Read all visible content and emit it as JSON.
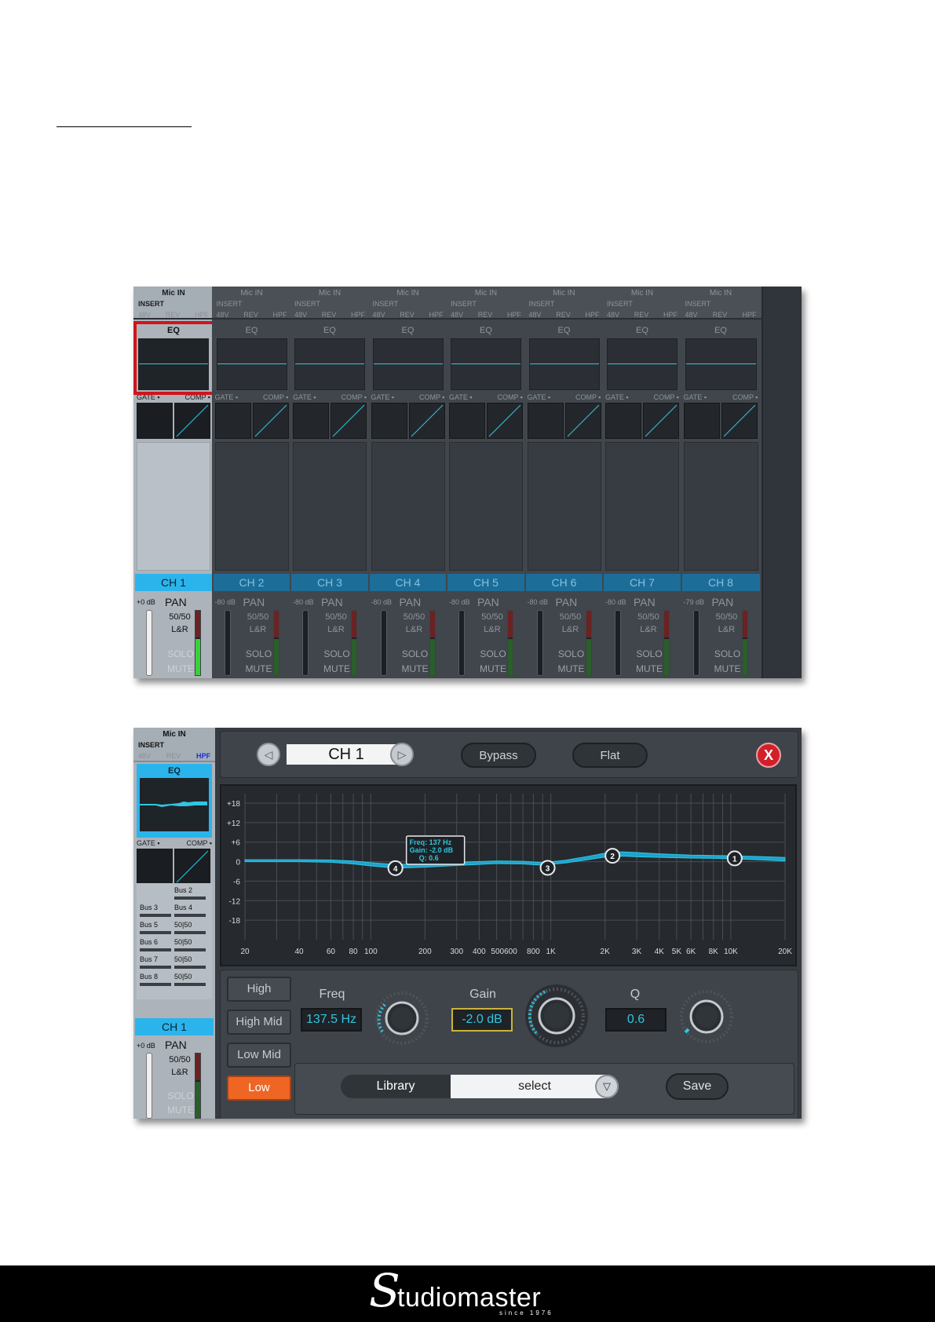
{
  "mixer": {
    "labels": {
      "mic": "Mic IN",
      "insert": "INSERT",
      "p48": "48V",
      "rev": "REV",
      "hpf": "HPF",
      "eq": "EQ",
      "gate": "GATE ▪",
      "comp": "COMP ▪",
      "pan": "PAN",
      "pan_value": "50/50",
      "pan_route": "L&R",
      "solo": "SOLO",
      "mute": "MUTE"
    },
    "channels": [
      {
        "name": "CH 1",
        "db": "+0 dB",
        "selected": true
      },
      {
        "name": "CH 2",
        "db": "-80 dB"
      },
      {
        "name": "CH 3",
        "db": "-80 dB"
      },
      {
        "name": "CH 4",
        "db": "-80 dB"
      },
      {
        "name": "CH 5",
        "db": "-80 dB"
      },
      {
        "name": "CH 6",
        "db": "-80 dB"
      },
      {
        "name": "CH 7",
        "db": "-80 dB"
      },
      {
        "name": "CH 8",
        "db": "-79 dB"
      }
    ],
    "highlight_color": "#d1141c"
  },
  "side": {
    "buses": [
      {
        "left": "",
        "right": "Bus 2"
      },
      {
        "left": "Bus 3",
        "right": "Bus 4"
      },
      {
        "left": "Bus 5",
        "right": "50|50"
      },
      {
        "left": "Bus 6",
        "right": "50|50"
      },
      {
        "left": "Bus 7",
        "right": "50|50"
      },
      {
        "left": "Bus 8",
        "right": "50|50"
      }
    ],
    "channel": "CH 1",
    "db": "+0 dB"
  },
  "eq": {
    "channel": "CH 1",
    "prev_icon": "triangle-left-icon",
    "next_icon": "triangle-right-icon",
    "bypass": "Bypass",
    "flat": "Flat",
    "close": "X",
    "y_ticks": [
      "+18",
      "+12",
      "+6",
      "0",
      "-6",
      "-12",
      "-18"
    ],
    "x_ticks": [
      "20",
      "40",
      "60",
      "80",
      "100",
      "200",
      "300",
      "400",
      "500600",
      "800",
      "1K",
      "2K",
      "3K",
      "4K",
      "5K",
      "6K",
      "8K",
      "10K",
      "20K"
    ],
    "tooltip": {
      "line1": "Freq: 137 Hz",
      "line2": "Gain: -2.0 dB",
      "line3": "Q: 0.6"
    },
    "points": [
      {
        "label": "1",
        "freq": 10500,
        "gain": 1.0
      },
      {
        "label": "2",
        "freq": 2200,
        "gain": 1.8
      },
      {
        "label": "3",
        "freq": 960,
        "gain": -1.9
      },
      {
        "label": "4",
        "freq": 137,
        "gain": -2.0
      }
    ],
    "curve": {
      "freq": [
        20,
        40,
        60,
        80,
        100,
        137,
        200,
        300,
        500,
        700,
        900,
        1200,
        1600,
        2000,
        2500,
        3000,
        4000,
        6000,
        8000,
        10000,
        14000,
        20000
      ],
      "upper": [
        0.6,
        0.6,
        0.5,
        0.2,
        -0.3,
        -0.9,
        -0.6,
        -0.2,
        0.2,
        0.1,
        -0.3,
        0.4,
        1.6,
        2.6,
        3.0,
        2.8,
        2.4,
        2.0,
        1.9,
        1.8,
        1.6,
        1.3
      ],
      "lower": [
        0.0,
        0.0,
        -0.2,
        -0.7,
        -1.3,
        -2.0,
        -1.7,
        -1.2,
        -0.6,
        -0.7,
        -1.1,
        -0.4,
        0.6,
        1.4,
        1.7,
        1.5,
        1.3,
        1.1,
        1.0,
        0.9,
        0.6,
        0.2
      ]
    },
    "bands": [
      "High",
      "High Mid",
      "Low Mid",
      "Low"
    ],
    "active_band": "Low",
    "params": {
      "freq_label": "Freq",
      "freq_value": "137.5 Hz",
      "gain_label": "Gain",
      "gain_value": "-2.0 dB",
      "q_label": "Q",
      "q_value": "0.6"
    },
    "library": "Library",
    "select": "select",
    "select_icon": "triangle-down-icon",
    "save": "Save",
    "accent": "#2fc6df"
  },
  "footer": {
    "logo_word": "tudiomaster",
    "logo_initial": "S",
    "since": "since 1976"
  }
}
